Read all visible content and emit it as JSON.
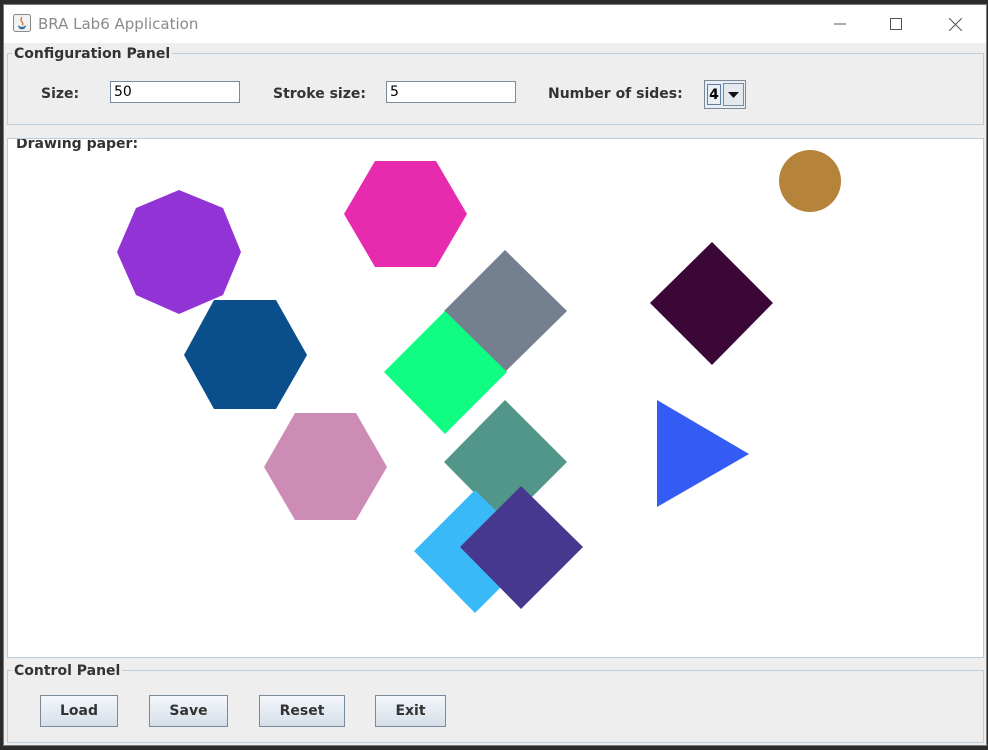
{
  "window": {
    "title": "BRA Lab6 Application"
  },
  "config": {
    "title": "Configuration Panel",
    "size_label": "Size:",
    "size_value": "50",
    "stroke_label": "Stroke size:",
    "stroke_value": "5",
    "sides_label": "Number of sides:",
    "sides_value": "4"
  },
  "drawing": {
    "title": "Drawing paper:",
    "shapes": [
      {
        "color": "#e62bae",
        "label": "hexagon"
      },
      {
        "color": "#9233d6",
        "label": "octagon"
      },
      {
        "color": "#b5843a",
        "label": "circle"
      },
      {
        "color": "#74808f",
        "label": "square"
      },
      {
        "color": "#3a0736",
        "label": "square"
      },
      {
        "color": "#0b4e8c",
        "label": "hexagon"
      },
      {
        "color": "#10fc83",
        "label": "square"
      },
      {
        "color": "#cc8cb6",
        "label": "hexagon"
      },
      {
        "color": "#52968a",
        "label": "square"
      },
      {
        "color": "#345bf4",
        "label": "triangle"
      },
      {
        "color": "#3ab9f8",
        "label": "square"
      },
      {
        "color": "#46378f",
        "label": "square"
      }
    ]
  },
  "control": {
    "title": "Control Panel",
    "load_label": "Load",
    "save_label": "Save",
    "reset_label": "Reset",
    "exit_label": "Exit"
  }
}
